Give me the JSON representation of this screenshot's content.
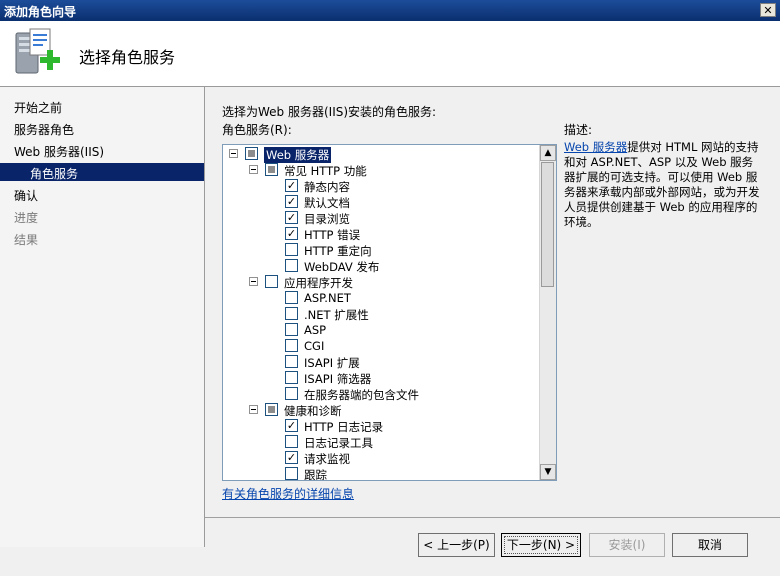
{
  "window": {
    "title": "添加角色向导",
    "close_glyph": "✕"
  },
  "header": {
    "title": "选择角色服务",
    "icon": "server-roles-add-icon"
  },
  "nav": {
    "items": [
      {
        "label": "开始之前",
        "state": "normal"
      },
      {
        "label": "服务器角色",
        "state": "normal"
      },
      {
        "label": "Web 服务器(IIS)",
        "state": "normal"
      },
      {
        "label": "角色服务",
        "state": "selected"
      },
      {
        "label": "确认",
        "state": "normal"
      },
      {
        "label": "进度",
        "state": "disabled"
      },
      {
        "label": "结果",
        "state": "disabled"
      }
    ]
  },
  "main": {
    "prompt": "选择为Web 服务器(IIS)安装的角色服务:",
    "services_label": "角色服务(R):",
    "description_label": "描述:",
    "description_link": "Web 服务器",
    "description_text": "提供对 HTML 网站的支持和对 ASP.NET、ASP 以及 Web 服务器扩展的可选支持。可以使用 Web 服务器来承载内部或外部网站，或为开发人员提供创建基于 Web 的应用程序的环境。",
    "more_info_link": "有关角色服务的详细信息"
  },
  "tree": [
    {
      "label": "Web 服务器",
      "level": 0,
      "expander": true,
      "check": "partial",
      "selected": true
    },
    {
      "label": "常见 HTTP 功能",
      "level": 1,
      "expander": true,
      "check": "partial"
    },
    {
      "label": "静态内容",
      "level": 2,
      "check": "checked"
    },
    {
      "label": "默认文档",
      "level": 2,
      "check": "checked"
    },
    {
      "label": "目录浏览",
      "level": 2,
      "check": "checked"
    },
    {
      "label": "HTTP 错误",
      "level": 2,
      "check": "checked"
    },
    {
      "label": "HTTP 重定向",
      "level": 2,
      "check": "unchecked"
    },
    {
      "label": "WebDAV 发布",
      "level": 2,
      "check": "unchecked"
    },
    {
      "label": "应用程序开发",
      "level": 1,
      "expander": true,
      "check": "unchecked"
    },
    {
      "label": "ASP.NET",
      "level": 2,
      "check": "unchecked"
    },
    {
      "label": ".NET 扩展性",
      "level": 2,
      "check": "unchecked"
    },
    {
      "label": "ASP",
      "level": 2,
      "check": "unchecked"
    },
    {
      "label": "CGI",
      "level": 2,
      "check": "unchecked"
    },
    {
      "label": "ISAPI 扩展",
      "level": 2,
      "check": "unchecked"
    },
    {
      "label": "ISAPI 筛选器",
      "level": 2,
      "check": "unchecked"
    },
    {
      "label": "在服务器端的包含文件",
      "level": 2,
      "check": "unchecked"
    },
    {
      "label": "健康和诊断",
      "level": 1,
      "expander": true,
      "check": "partial"
    },
    {
      "label": "HTTP 日志记录",
      "level": 2,
      "check": "checked"
    },
    {
      "label": "日志记录工具",
      "level": 2,
      "check": "unchecked"
    },
    {
      "label": "请求监视",
      "level": 2,
      "check": "checked"
    },
    {
      "label": "跟踪",
      "level": 2,
      "check": "unchecked"
    }
  ],
  "scroll": {
    "up_glyph": "▲",
    "down_glyph": "▼"
  },
  "buttons": {
    "back": "< 上一步(P)",
    "next": "下一步(N) >",
    "install": "安装(I)",
    "cancel": "取消"
  }
}
